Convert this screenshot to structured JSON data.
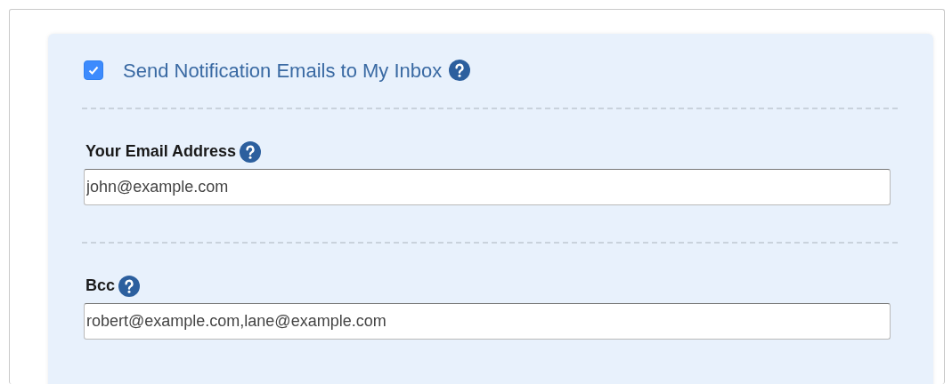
{
  "notify": {
    "label": "Send Notification Emails to My Inbox",
    "checked": true
  },
  "fields": [
    {
      "label": "Your Email Address",
      "value": "john@example.com"
    },
    {
      "label": "Bcc",
      "value": "robert@example.com,lane@example.com"
    }
  ]
}
